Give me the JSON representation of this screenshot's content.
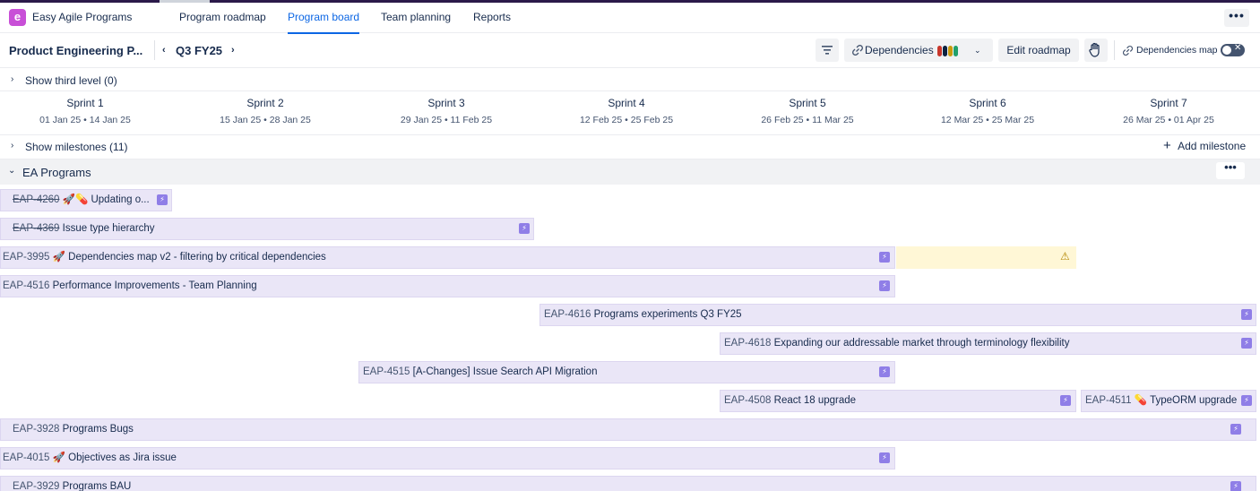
{
  "app": {
    "logo_letter": "e",
    "name": "Easy Agile Programs"
  },
  "nav": {
    "tabs": [
      "Program roadmap",
      "Program board",
      "Team planning",
      "Reports"
    ],
    "active": "Program board"
  },
  "toolbar": {
    "program_name": "Product Engineering P...",
    "period": "Q3 FY25",
    "dependencies_label": "Dependencies",
    "dependency_colors": [
      "#c9372c",
      "#0c2240",
      "#c99a0c",
      "#22a06b"
    ],
    "edit_roadmap": "Edit roadmap",
    "dependencies_map": "Dependencies map"
  },
  "third_level": "Show third level (0)",
  "sprints": [
    {
      "name": "Sprint 1",
      "dates": "01 Jan 25 • 14 Jan 25"
    },
    {
      "name": "Sprint 2",
      "dates": "15 Jan 25 • 28 Jan 25"
    },
    {
      "name": "Sprint 3",
      "dates": "29 Jan 25 • 11 Feb 25"
    },
    {
      "name": "Sprint 4",
      "dates": "12 Feb 25 • 25 Feb 25"
    },
    {
      "name": "Sprint 5",
      "dates": "26 Feb 25 • 11 Mar 25"
    },
    {
      "name": "Sprint 6",
      "dates": "12 Mar 25 • 25 Mar 25"
    },
    {
      "name": "Sprint 7",
      "dates": "26 Mar 25 • 01 Apr 25"
    }
  ],
  "milestones": {
    "label": "Show milestones (11)",
    "add": "Add milestone"
  },
  "group": {
    "name": "EA Programs"
  },
  "issues": [
    {
      "key": "EAP-4260",
      "title": "🚀💊 Updating o...",
      "done": true
    },
    {
      "key": "EAP-4369",
      "title": "Issue type hierarchy",
      "done": true
    },
    {
      "key": "EAP-3995",
      "title": "🚀 Dependencies map v2 - filtering by critical dependencies",
      "done": false
    },
    {
      "key": "EAP-4516",
      "title": "Performance Improvements - Team Planning",
      "done": false
    },
    {
      "key": "EAP-4616",
      "title": "Programs experiments Q3 FY25",
      "done": false
    },
    {
      "key": "EAP-4618",
      "title": "Expanding our addressable market through terminology flexibility",
      "done": false
    },
    {
      "key": "EAP-4515",
      "title": "[A-Changes] Issue Search API Migration",
      "done": false
    },
    {
      "key": "EAP-4508",
      "title": "React 18 upgrade",
      "done": false
    },
    {
      "key": "EAP-4511",
      "title": "💊 TypeORM upgrade",
      "done": false
    },
    {
      "key": "EAP-3928",
      "title": "Programs Bugs",
      "done": false
    },
    {
      "key": "EAP-4015",
      "title": "🚀 Objectives as Jira issue",
      "done": false
    },
    {
      "key": "EAP-3929",
      "title": "Programs BAU",
      "done": false
    }
  ]
}
